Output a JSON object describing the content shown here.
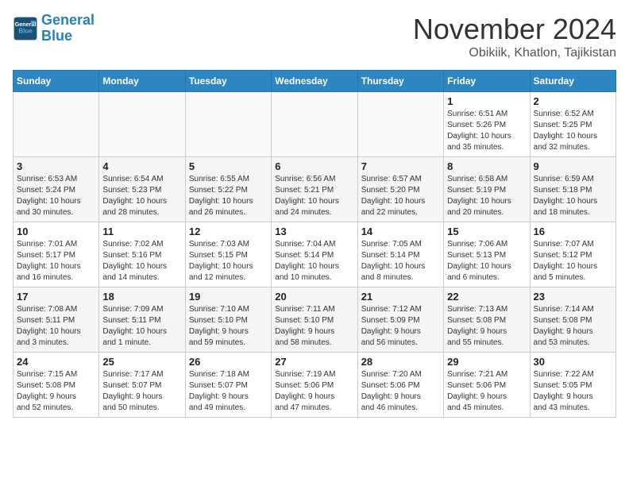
{
  "header": {
    "logo_line1": "General",
    "logo_line2": "Blue",
    "month_title": "November 2024",
    "subtitle": "Obikiik, Khatlon, Tajikistan"
  },
  "weekdays": [
    "Sunday",
    "Monday",
    "Tuesday",
    "Wednesday",
    "Thursday",
    "Friday",
    "Saturday"
  ],
  "weeks": [
    [
      {
        "day": "",
        "info": ""
      },
      {
        "day": "",
        "info": ""
      },
      {
        "day": "",
        "info": ""
      },
      {
        "day": "",
        "info": ""
      },
      {
        "day": "",
        "info": ""
      },
      {
        "day": "1",
        "info": "Sunrise: 6:51 AM\nSunset: 5:26 PM\nDaylight: 10 hours\nand 35 minutes."
      },
      {
        "day": "2",
        "info": "Sunrise: 6:52 AM\nSunset: 5:25 PM\nDaylight: 10 hours\nand 32 minutes."
      }
    ],
    [
      {
        "day": "3",
        "info": "Sunrise: 6:53 AM\nSunset: 5:24 PM\nDaylight: 10 hours\nand 30 minutes."
      },
      {
        "day": "4",
        "info": "Sunrise: 6:54 AM\nSunset: 5:23 PM\nDaylight: 10 hours\nand 28 minutes."
      },
      {
        "day": "5",
        "info": "Sunrise: 6:55 AM\nSunset: 5:22 PM\nDaylight: 10 hours\nand 26 minutes."
      },
      {
        "day": "6",
        "info": "Sunrise: 6:56 AM\nSunset: 5:21 PM\nDaylight: 10 hours\nand 24 minutes."
      },
      {
        "day": "7",
        "info": "Sunrise: 6:57 AM\nSunset: 5:20 PM\nDaylight: 10 hours\nand 22 minutes."
      },
      {
        "day": "8",
        "info": "Sunrise: 6:58 AM\nSunset: 5:19 PM\nDaylight: 10 hours\nand 20 minutes."
      },
      {
        "day": "9",
        "info": "Sunrise: 6:59 AM\nSunset: 5:18 PM\nDaylight: 10 hours\nand 18 minutes."
      }
    ],
    [
      {
        "day": "10",
        "info": "Sunrise: 7:01 AM\nSunset: 5:17 PM\nDaylight: 10 hours\nand 16 minutes."
      },
      {
        "day": "11",
        "info": "Sunrise: 7:02 AM\nSunset: 5:16 PM\nDaylight: 10 hours\nand 14 minutes."
      },
      {
        "day": "12",
        "info": "Sunrise: 7:03 AM\nSunset: 5:15 PM\nDaylight: 10 hours\nand 12 minutes."
      },
      {
        "day": "13",
        "info": "Sunrise: 7:04 AM\nSunset: 5:14 PM\nDaylight: 10 hours\nand 10 minutes."
      },
      {
        "day": "14",
        "info": "Sunrise: 7:05 AM\nSunset: 5:14 PM\nDaylight: 10 hours\nand 8 minutes."
      },
      {
        "day": "15",
        "info": "Sunrise: 7:06 AM\nSunset: 5:13 PM\nDaylight: 10 hours\nand 6 minutes."
      },
      {
        "day": "16",
        "info": "Sunrise: 7:07 AM\nSunset: 5:12 PM\nDaylight: 10 hours\nand 5 minutes."
      }
    ],
    [
      {
        "day": "17",
        "info": "Sunrise: 7:08 AM\nSunset: 5:11 PM\nDaylight: 10 hours\nand 3 minutes."
      },
      {
        "day": "18",
        "info": "Sunrise: 7:09 AM\nSunset: 5:11 PM\nDaylight: 10 hours\nand 1 minute."
      },
      {
        "day": "19",
        "info": "Sunrise: 7:10 AM\nSunset: 5:10 PM\nDaylight: 9 hours\nand 59 minutes."
      },
      {
        "day": "20",
        "info": "Sunrise: 7:11 AM\nSunset: 5:10 PM\nDaylight: 9 hours\nand 58 minutes."
      },
      {
        "day": "21",
        "info": "Sunrise: 7:12 AM\nSunset: 5:09 PM\nDaylight: 9 hours\nand 56 minutes."
      },
      {
        "day": "22",
        "info": "Sunrise: 7:13 AM\nSunset: 5:08 PM\nDaylight: 9 hours\nand 55 minutes."
      },
      {
        "day": "23",
        "info": "Sunrise: 7:14 AM\nSunset: 5:08 PM\nDaylight: 9 hours\nand 53 minutes."
      }
    ],
    [
      {
        "day": "24",
        "info": "Sunrise: 7:15 AM\nSunset: 5:08 PM\nDaylight: 9 hours\nand 52 minutes."
      },
      {
        "day": "25",
        "info": "Sunrise: 7:17 AM\nSunset: 5:07 PM\nDaylight: 9 hours\nand 50 minutes."
      },
      {
        "day": "26",
        "info": "Sunrise: 7:18 AM\nSunset: 5:07 PM\nDaylight: 9 hours\nand 49 minutes."
      },
      {
        "day": "27",
        "info": "Sunrise: 7:19 AM\nSunset: 5:06 PM\nDaylight: 9 hours\nand 47 minutes."
      },
      {
        "day": "28",
        "info": "Sunrise: 7:20 AM\nSunset: 5:06 PM\nDaylight: 9 hours\nand 46 minutes."
      },
      {
        "day": "29",
        "info": "Sunrise: 7:21 AM\nSunset: 5:06 PM\nDaylight: 9 hours\nand 45 minutes."
      },
      {
        "day": "30",
        "info": "Sunrise: 7:22 AM\nSunset: 5:05 PM\nDaylight: 9 hours\nand 43 minutes."
      }
    ]
  ]
}
